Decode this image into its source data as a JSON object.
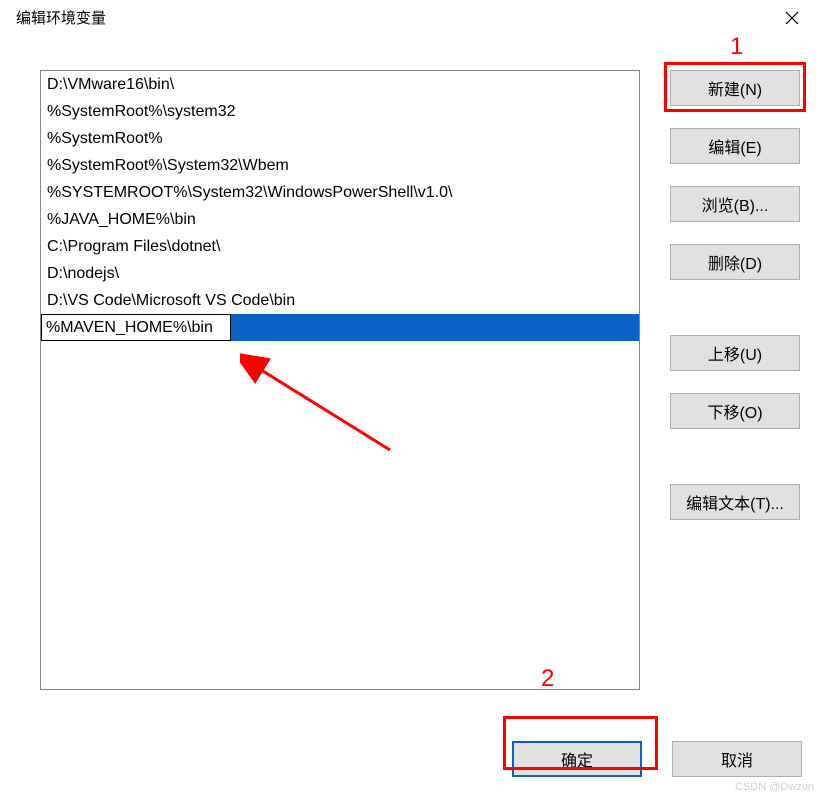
{
  "title": "编辑环境变量",
  "list_items": [
    "D:\\VMware16\\bin\\",
    "%SystemRoot%\\system32",
    "%SystemRoot%",
    "%SystemRoot%\\System32\\Wbem",
    "%SYSTEMROOT%\\System32\\WindowsPowerShell\\v1.0\\",
    "%JAVA_HOME%\\bin",
    "C:\\Program Files\\dotnet\\",
    "D:\\nodejs\\",
    "D:\\VS Code\\Microsoft VS Code\\bin"
  ],
  "editing_value": "%MAVEN_HOME%\\bin",
  "buttons": {
    "new": "新建(N)",
    "edit": "编辑(E)",
    "browse": "浏览(B)...",
    "delete": "删除(D)",
    "moveup": "上移(U)",
    "movedown": "下移(O)",
    "edittext": "编辑文本(T)...",
    "ok": "确定",
    "cancel": "取消"
  },
  "annotations": {
    "label1": "1",
    "label2": "2"
  },
  "watermark": "CSDN @Dwzun"
}
